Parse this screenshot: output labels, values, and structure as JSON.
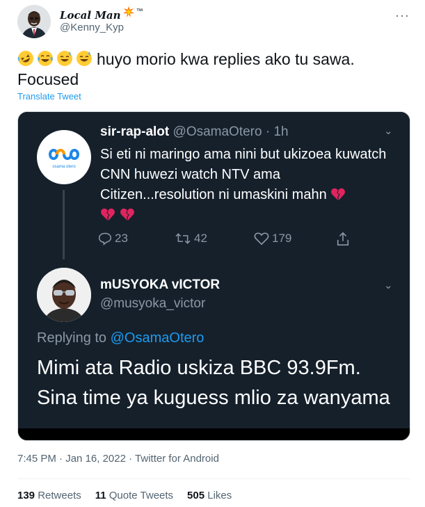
{
  "author": {
    "display_name": "Local Man",
    "badge_icon": "collision-icon",
    "trademark": "™",
    "handle": "@Kenny_Kyp"
  },
  "tweet": {
    "emojis": [
      "rolling-on-floor-laughing",
      "face-with-tears-of-joy",
      "grinning-face-with-sweat",
      "grinning-face-with-sweat"
    ],
    "text_line1": "huyo morio kwa replies ako tu sawa.",
    "text_line2": "Focused",
    "translate_label": "Translate Tweet"
  },
  "media": {
    "first_tweet": {
      "avatar_logo_text": "osama otero",
      "name": "sir-rap-alot",
      "handle_time": "@OsamaOtero · 1h",
      "text": "Si eti ni maringo ama nini but ukizoea kuwatch CNN huwezi watch NTV ama Citizen...resolution ni umaskini mahn",
      "reply_count": "23",
      "retweet_count": "42",
      "like_count": "179"
    },
    "reply_tweet": {
      "name": "mUSYOKA vICTOR",
      "handle": "@musyoka_victor",
      "replying_prefix": "Replying to",
      "replying_handle": "@OsamaOtero",
      "text_line1": "Mimi ata Radio uskiza BBC 93.9Fm.",
      "text_line2": "Sina time ya kuguess mlio za wanyama"
    }
  },
  "meta": {
    "time": "7:45 PM",
    "date": "Jan 16, 2022",
    "source": "Twitter for Android"
  },
  "stats": {
    "retweets_count": "139",
    "retweets_label": "Retweets",
    "quotes_count": "11",
    "quotes_label": "Quote Tweets",
    "likes_count": "505",
    "likes_label": "Likes"
  },
  "colors": {
    "link_blue": "#1d9bf0",
    "dark_bg": "#15202b",
    "muted_gray": "#536471",
    "heart_red": "#e0245e"
  }
}
